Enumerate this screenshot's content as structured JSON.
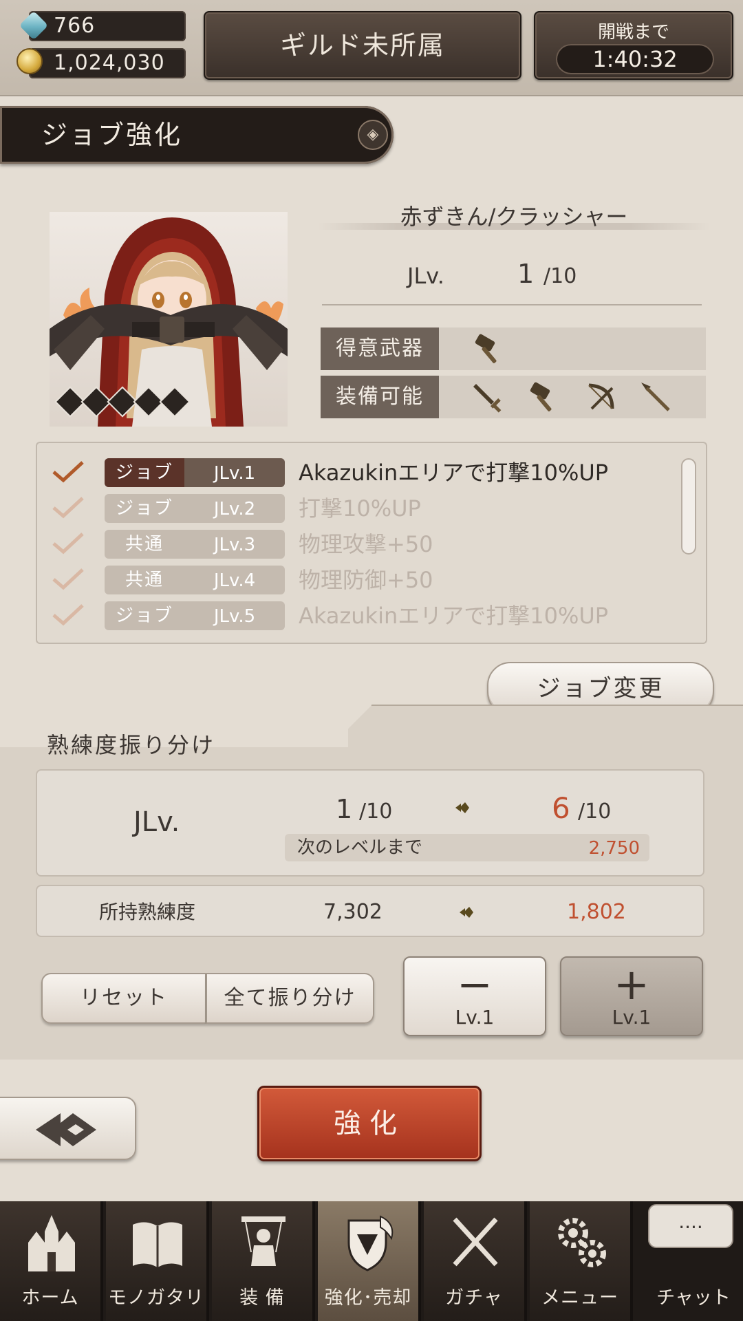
{
  "top_bar": {
    "gems": "766",
    "coins": "1,024,030",
    "guild": "ギルド未所属",
    "timer_label": "開戦まで",
    "timer_value": "1:40:32"
  },
  "header": {
    "title": "ジョブ強化"
  },
  "character": {
    "name": "赤ずきん/クラッシャー",
    "jlv_label": "JLv.",
    "jlv_current": "1",
    "jlv_max": "/10",
    "rank_diamonds": 5,
    "favored_weapon_label": "得意武器",
    "favored_weapons": [
      "hammer-icon"
    ],
    "equippable_label": "装備可能",
    "equippable_weapons": [
      "sword-icon",
      "hammer-icon",
      "bow-icon",
      "spear-icon"
    ]
  },
  "skills": [
    {
      "type": "ジョブ",
      "level": "JLv.1",
      "text": "Akazukinエリアで打撃10%UP",
      "active": true
    },
    {
      "type": "ジョブ",
      "level": "JLv.2",
      "text": "打撃10%UP",
      "active": false
    },
    {
      "type": "共通",
      "level": "JLv.3",
      "text": "物理攻撃+50",
      "active": false
    },
    {
      "type": "共通",
      "level": "JLv.4",
      "text": "物理防御+50",
      "active": false
    },
    {
      "type": "ジョブ",
      "level": "JLv.5",
      "text": "Akazukinエリアで打撃10%UP",
      "active": false
    }
  ],
  "job_change_label": "ジョブ変更",
  "allocation": {
    "title": "熟練度振り分け",
    "jlv_label": "JLv.",
    "from_level": "1",
    "from_max": "/10",
    "to_level": "6",
    "to_max": "/10",
    "next_label": "次のレベルまで",
    "next_value": "2,750",
    "proficiency_label": "所持熟練度",
    "proficiency_from": "7,302",
    "proficiency_to": "1,802",
    "reset_label": "リセット",
    "allot_all_label": "全て振り分け",
    "minus_sign": "−",
    "minus_label": "Lv.1",
    "plus_sign": "+",
    "plus_label": "Lv.1"
  },
  "enhance_label": "強化",
  "nav": {
    "items": [
      {
        "label": "ホーム",
        "icon": "castle-icon"
      },
      {
        "label": "モノガタリ",
        "icon": "book-icon"
      },
      {
        "label": "装 備",
        "icon": "puppet-icon"
      },
      {
        "label": "強化･売却",
        "icon": "shield-icon"
      },
      {
        "label": "ガチャ",
        "icon": "crossed-swords-icon"
      },
      {
        "label": "メニュー",
        "icon": "gears-icon"
      }
    ],
    "chat_bubble": "....",
    "chat_label": "チャット"
  },
  "colors": {
    "accent_red": "#c05030",
    "active_skill_tag": "#5b3329",
    "enhance_button": "#b8401f"
  }
}
